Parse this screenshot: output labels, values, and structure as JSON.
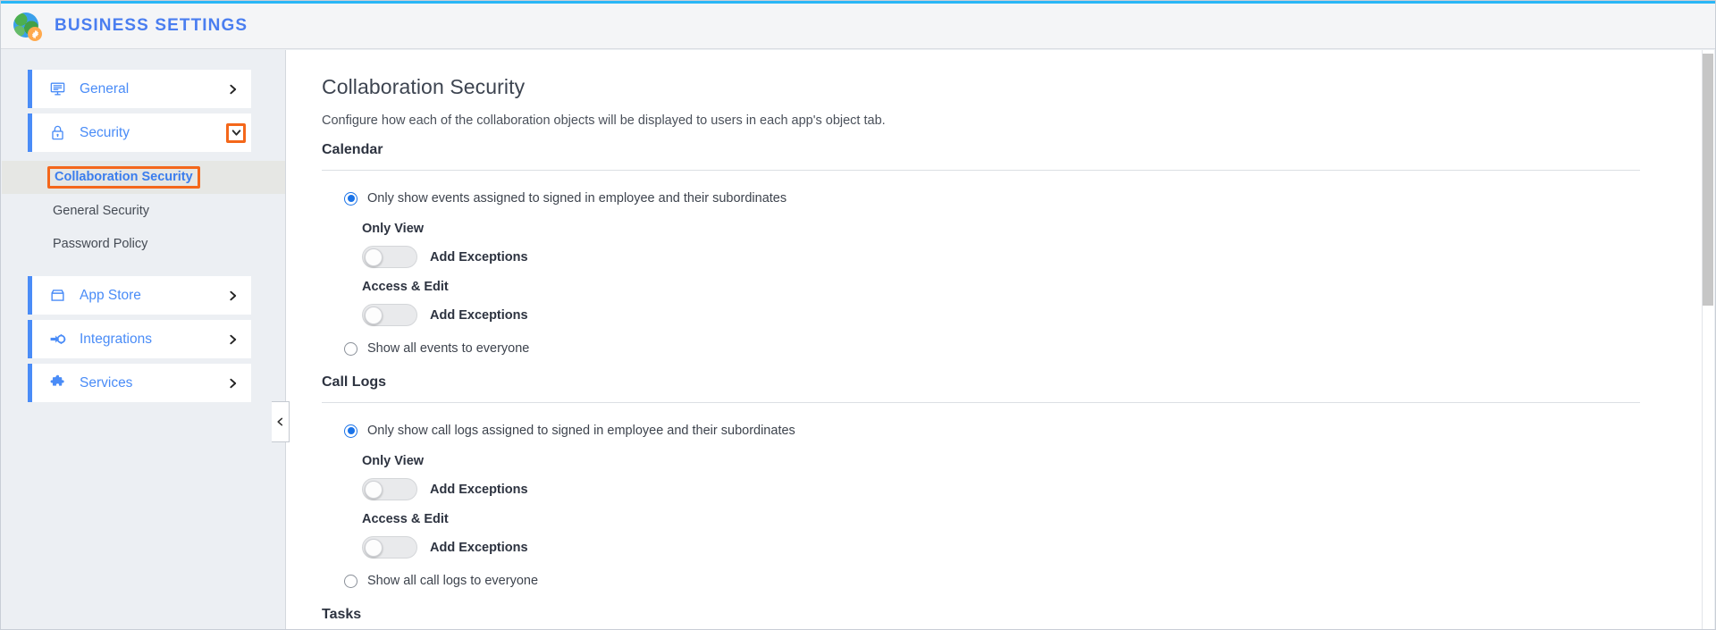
{
  "topbar": {
    "brand_title": "BUSINESS SETTINGS",
    "logo_icon": "globe-gear-icon",
    "accent_color": "#29b6f6",
    "brand_color": "#4a7ef0"
  },
  "sidebar": {
    "highlight_color": "#f4671a",
    "items": [
      {
        "label": "General",
        "icon": "monitor-icon",
        "chevron": "chevron-right-icon",
        "expanded": false,
        "highlighted": false
      },
      {
        "label": "Security",
        "icon": "lock-icon",
        "chevron": "chevron-down-icon",
        "expanded": true,
        "highlighted": true
      },
      {
        "label": "App Store",
        "icon": "storefront-icon",
        "chevron": "chevron-right-icon",
        "expanded": false,
        "highlighted": false
      },
      {
        "label": "Integrations",
        "icon": "plug-gear-icon",
        "chevron": "chevron-right-icon",
        "expanded": false,
        "highlighted": false
      },
      {
        "label": "Services",
        "icon": "puzzle-piece-icon",
        "chevron": "chevron-right-icon",
        "expanded": false,
        "highlighted": false
      }
    ],
    "security_subitems": [
      {
        "label": "Collaboration Security",
        "active": true
      },
      {
        "label": "General Security",
        "active": false
      },
      {
        "label": "Password Policy",
        "active": false
      }
    ],
    "collapse_handle_icon": "chevron-left-icon"
  },
  "main": {
    "page_title": "Collaboration Security",
    "page_subtitle": "Configure how each of the collaboration objects will be displayed to users in each app's object tab.",
    "sections": [
      {
        "title": "Calendar",
        "restricted_radio_label": "Only show events assigned to signed in employee and their subordinates",
        "restricted_selected": true,
        "only_view_heading": "Only View",
        "only_view_toggle_label": "Add Exceptions",
        "only_view_toggle_on": false,
        "access_edit_heading": "Access & Edit",
        "access_edit_toggle_label": "Add Exceptions",
        "access_edit_toggle_on": false,
        "open_radio_label": "Show all events to everyone",
        "open_selected": false
      },
      {
        "title": "Call Logs",
        "restricted_radio_label": "Only show call logs assigned to signed in employee and their subordinates",
        "restricted_selected": true,
        "only_view_heading": "Only View",
        "only_view_toggle_label": "Add Exceptions",
        "only_view_toggle_on": false,
        "access_edit_heading": "Access & Edit",
        "access_edit_toggle_label": "Add Exceptions",
        "access_edit_toggle_on": false,
        "open_radio_label": "Show all call logs to everyone",
        "open_selected": false
      },
      {
        "title": "Tasks",
        "partial": true
      }
    ]
  }
}
